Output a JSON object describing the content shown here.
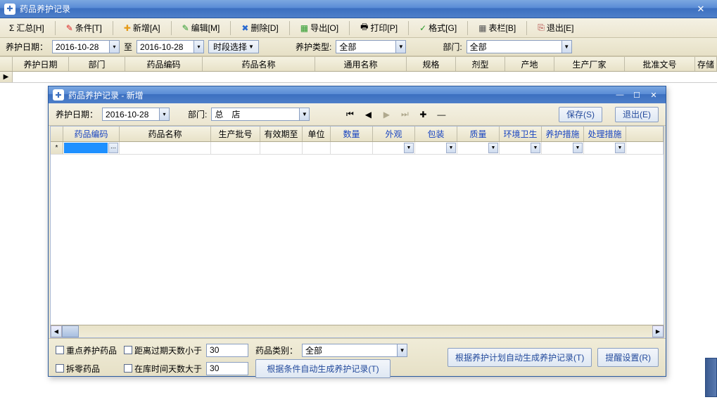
{
  "window": {
    "title": "药品养护记录",
    "close": "✕"
  },
  "toolbar": {
    "summary": "汇总[H]",
    "condition": "条件[T]",
    "add": "新增[A]",
    "edit": "编辑[M]",
    "delete": "删除[D]",
    "export": "导出[O]",
    "print": "打印[P]",
    "format": "格式[G]",
    "columns": "表栏[B]",
    "exit": "退出[E]"
  },
  "filter": {
    "date_label": "养护日期：",
    "date_from": "2016-10-28",
    "to": "至",
    "date_to": "2016-10-28",
    "time_select": "时段选择",
    "type_label": "养护类型:",
    "type_value": "全部",
    "dept_label": "部门:",
    "dept_value": "全部"
  },
  "grid_cols": [
    "养护日期",
    "部门",
    "药品编码",
    "药品名称",
    "通用名称",
    "规格",
    "剂型",
    "产地",
    "生产厂家",
    "批准文号",
    "存储"
  ],
  "child": {
    "title": "药品养护记录 - 新增",
    "filter": {
      "date_label": "养护日期：",
      "date": "2016-10-28",
      "dept_label": "部门:",
      "dept_value": "总　店",
      "save": "保存(S)",
      "exit": "退出(E)"
    },
    "cols": [
      "药品编码",
      "药品名称",
      "生产批号",
      "有效期至",
      "单位",
      "数量",
      "外观",
      "包装",
      "质量",
      "环境卫生",
      "养护措施",
      "处理措施"
    ],
    "bottom": {
      "chk_key": "重点养护药品",
      "chk_expire": "距离过期天数小于",
      "expire_val": "30",
      "cat_label": "药品类别：",
      "cat_val": "全部",
      "chk_split": "拆零药品",
      "chk_stock": "在库时间天数大于",
      "stock_val": "30",
      "btn_cond": "根据条件自动生成养护记录(T)",
      "btn_plan": "根据养护计划自动生成养护记录(T)",
      "btn_remind": "提醒设置(R)"
    }
  }
}
